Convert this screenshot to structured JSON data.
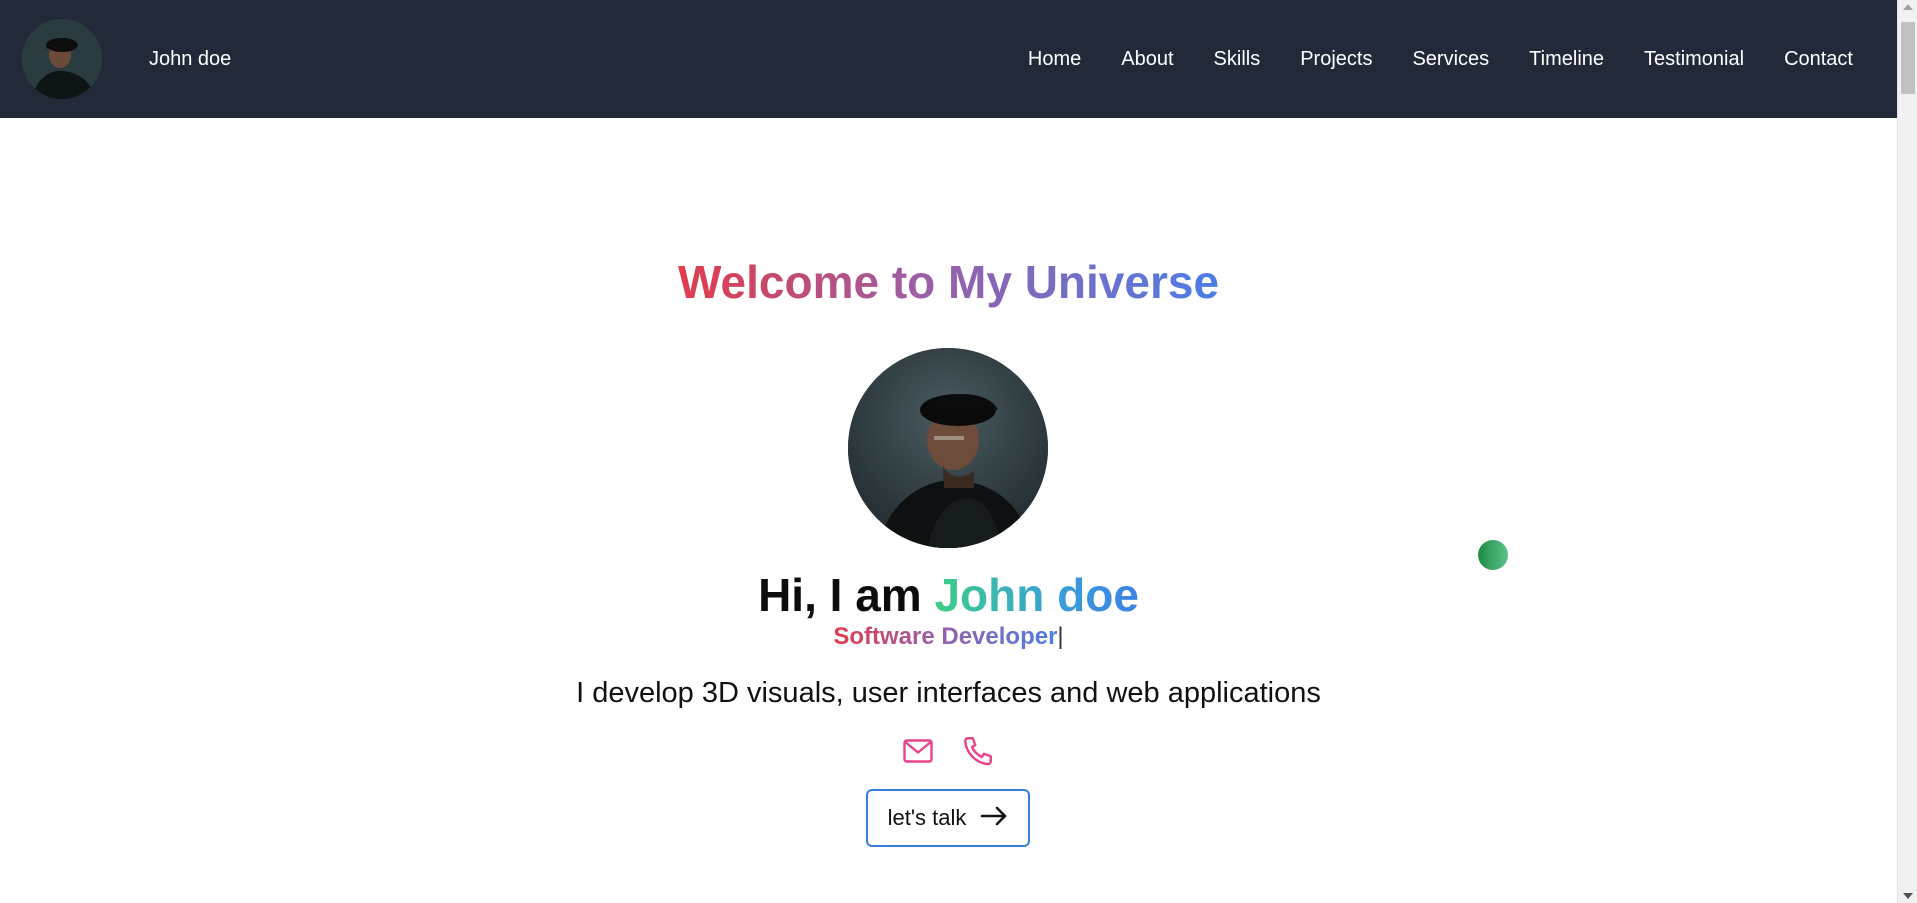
{
  "navbar": {
    "brand_name": "John doe",
    "links": [
      "Home",
      "About",
      "Skills",
      "Projects",
      "Services",
      "Timeline",
      "Testimonial",
      "Contact"
    ]
  },
  "hero": {
    "title": "Welcome to My Universe",
    "intro_prefix": "Hi, I am ",
    "intro_name": "John doe",
    "role": "Software Developer",
    "cursor": "|",
    "tagline": "I develop 3D visuals, user interfaces and web applications",
    "cta_label": "let's talk"
  },
  "icons": {
    "contact": [
      "mail-icon",
      "phone-icon"
    ],
    "cta": "arrow-right-icon"
  },
  "colors": {
    "navbar_bg": "#222a3a",
    "title_gradient": [
      "#e23b4b",
      "#9b5fa6",
      "#4b7de8"
    ],
    "name_gradient": [
      "#3ccf86",
      "#3b82e6"
    ],
    "icon_pink": "#e8438a",
    "button_border": "#3b7ddd"
  }
}
